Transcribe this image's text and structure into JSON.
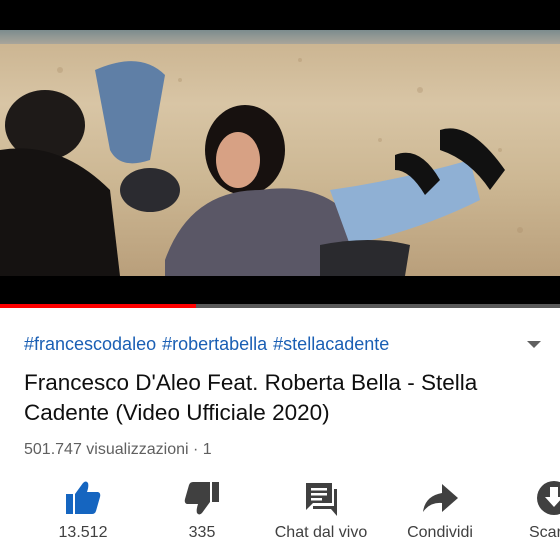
{
  "video": {
    "progress_fraction": 0.35
  },
  "hashtags": [
    "#francescodaleo",
    "#robertabella",
    "#stellacadente"
  ],
  "title_line1": "Francesco D'Aleo Feat. Roberta Bella - Stella",
  "title_line2": "Cadente (Video Ufficiale 2020)",
  "meta": {
    "views": "501.747 visualizzazioni",
    "separator": " · ",
    "age": "1"
  },
  "actions": {
    "like": {
      "label": "13.512",
      "icon": "thumb-up-icon"
    },
    "dislike": {
      "label": "335",
      "icon": "thumb-down-icon"
    },
    "chat": {
      "label": "Chat dal vivo",
      "icon": "chat-icon"
    },
    "share": {
      "label": "Condividi",
      "icon": "share-icon"
    },
    "download": {
      "label": "Scarica",
      "icon": "download-icon"
    }
  },
  "colors": {
    "link_blue": "#1a5fb4",
    "like_blue": "#1565c0",
    "progress_red": "#ff0000"
  }
}
